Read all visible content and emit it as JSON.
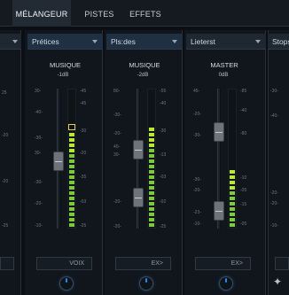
{
  "tabs": [
    {
      "label": "MÉLANGEUR",
      "active": true
    },
    {
      "label": "PISTES",
      "active": false
    },
    {
      "label": "EFFETS",
      "active": false
    }
  ],
  "strips": [
    {
      "preset": "Prétices",
      "name": "MUSIQUE",
      "db": "-1dB",
      "left_scale": [
        "30-",
        "-40-",
        "-30-",
        "30-",
        "-30-",
        "-20-",
        "-10-"
      ],
      "right_scale": [
        "-45",
        "-45",
        "-30",
        "-20",
        "-35",
        "-03",
        "-25"
      ],
      "button": "VOIX"
    },
    {
      "preset": "Pls:des",
      "name": "MUSIQUE",
      "db": "-2dB",
      "left_scale": [
        "80-",
        "-30-",
        "-20-",
        "40-",
        "30-",
        "-20-",
        "-20-"
      ],
      "right_scale": [
        "-55",
        "-40",
        "-30",
        "-13",
        "-03",
        "-02",
        "-25"
      ],
      "button": "EX>"
    },
    {
      "preset": "Lieterst",
      "name": "MASTER",
      "db": "0dB",
      "left_scale": [
        "45-",
        "-20-",
        "-30-",
        "-30-",
        "-20-",
        "-23-",
        "-10-"
      ],
      "right_scale": [
        "-85",
        "-40",
        "-80",
        "-10",
        "-05",
        "-15",
        "-05"
      ],
      "button": "EX>"
    }
  ],
  "partial_left": {
    "scale": [
      "25",
      "-20",
      "-20",
      "-25"
    ]
  },
  "partial_right": {
    "preset": "Stops",
    "scale": [
      "-30-",
      "-40-",
      "-20-",
      "-20-",
      "-10-"
    ]
  },
  "levels": {
    "strip1_fader": 0.4,
    "strip1_meter": 0.73,
    "strip2_fader_upper": 0.52,
    "strip2_fader_lower": 0.23,
    "strip2_meter": 0.77,
    "strip3_fader_upper": 0.78,
    "strip3_fader_lower": 0.18,
    "strip3_meter": 0.45
  }
}
